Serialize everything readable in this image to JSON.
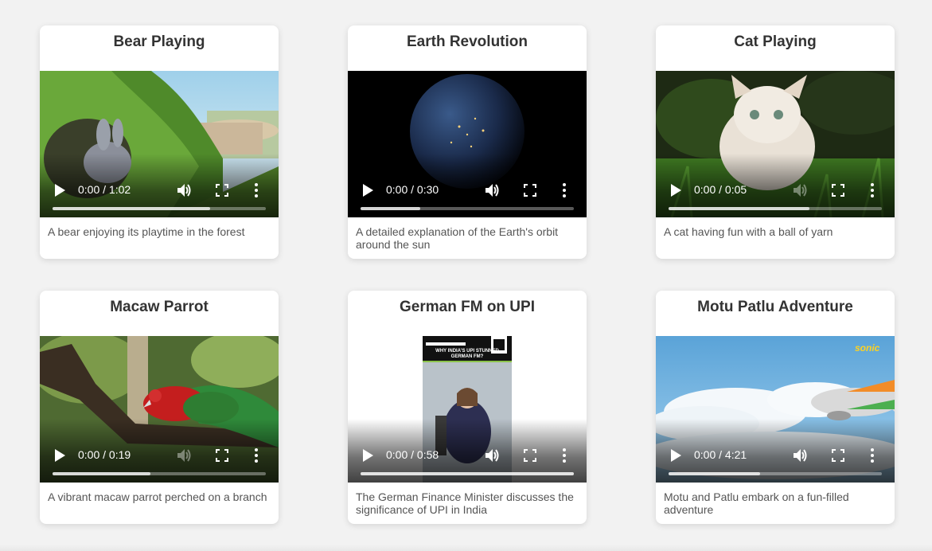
{
  "videos": [
    {
      "title": "Bear Playing",
      "time": "0:00 / 1:02",
      "buffered": 0.74,
      "description": "A bear enjoying its playtime in the forest"
    },
    {
      "title": "Earth Revolution",
      "time": "0:00 / 0:30",
      "buffered": 0.28,
      "description": "A detailed explanation of the Earth's orbit around the sun"
    },
    {
      "title": "Cat Playing",
      "time": "0:00 / 0:05",
      "buffered": 0.66,
      "description": "A cat having fun with a ball of yarn"
    },
    {
      "title": "Macaw Parrot",
      "time": "0:00 / 0:19",
      "buffered": 0.46,
      "description": "A vibrant macaw parrot perched on a branch"
    },
    {
      "title": "German FM on UPI",
      "time": "0:00 / 0:58",
      "buffered": 1.0,
      "description": "The German Finance Minister discusses the significance of UPI in India",
      "thumb_text": [
        "WHY INDIA'S UPI STUNNED",
        "GERMAN FM?"
      ]
    },
    {
      "title": "Motu Patlu Adventure",
      "time": "0:00 / 4:21",
      "buffered": 0.43,
      "description": "Motu and Patlu embark on a fun-filled adventure",
      "thumb_logo": "sonic"
    }
  ],
  "icons": {
    "play": "play-icon",
    "volume": "volume-icon",
    "fullscreen": "fullscreen-icon",
    "more": "more-options-icon"
  }
}
